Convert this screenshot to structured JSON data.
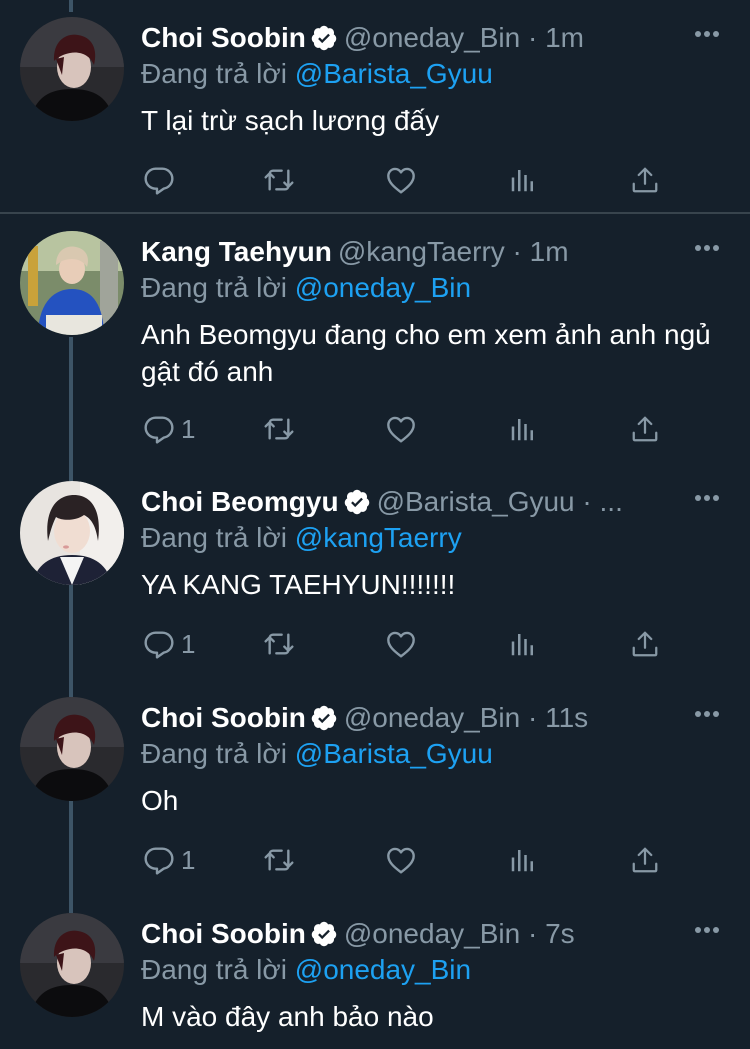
{
  "colors": {
    "background": "#15202b",
    "muted": "#8899a6",
    "link": "#1da1f2",
    "separator": "#38444d",
    "thread_line": "#3d5466"
  },
  "reply_prefix": "Đang trả lời",
  "tweets": [
    {
      "name": "Choi Soobin",
      "verified": true,
      "handle_time": "@oneday_Bin · 1m",
      "reply_to": "@Barista_Gyuu",
      "text": "T lại trừ sạch lương đấy",
      "reply_count": "",
      "avatar": "avatar-soobin"
    },
    {
      "name": "Kang Taehyun",
      "verified": false,
      "handle_time": "@kangTaerry · 1m",
      "reply_to": "@oneday_Bin",
      "text": "Anh Beomgyu đang cho em xem ảnh anh ngủ gật đó anh",
      "reply_count": "1",
      "avatar": "avatar-taehyun"
    },
    {
      "name": "Choi Beomgyu",
      "verified": true,
      "handle_time": "@Barista_Gyuu · ...",
      "reply_to": "@kangTaerry",
      "text": "YA KANG TAEHYUN!!!!!!!",
      "reply_count": "1",
      "avatar": "avatar-beomgyu"
    },
    {
      "name": "Choi Soobin",
      "verified": true,
      "handle_time": "@oneday_Bin · 11s",
      "reply_to": "@Barista_Gyuu",
      "text": "Oh",
      "reply_count": "1",
      "avatar": "avatar-soobin"
    },
    {
      "name": "Choi Soobin",
      "verified": true,
      "handle_time": "@oneday_Bin · 7s",
      "reply_to": "@oneday_Bin",
      "text": "M vào đây anh bảo nào",
      "reply_count": "",
      "avatar": "avatar-soobin"
    }
  ],
  "action_icons": [
    "reply-icon",
    "retweet-icon",
    "like-icon",
    "analytics-icon",
    "share-icon"
  ]
}
